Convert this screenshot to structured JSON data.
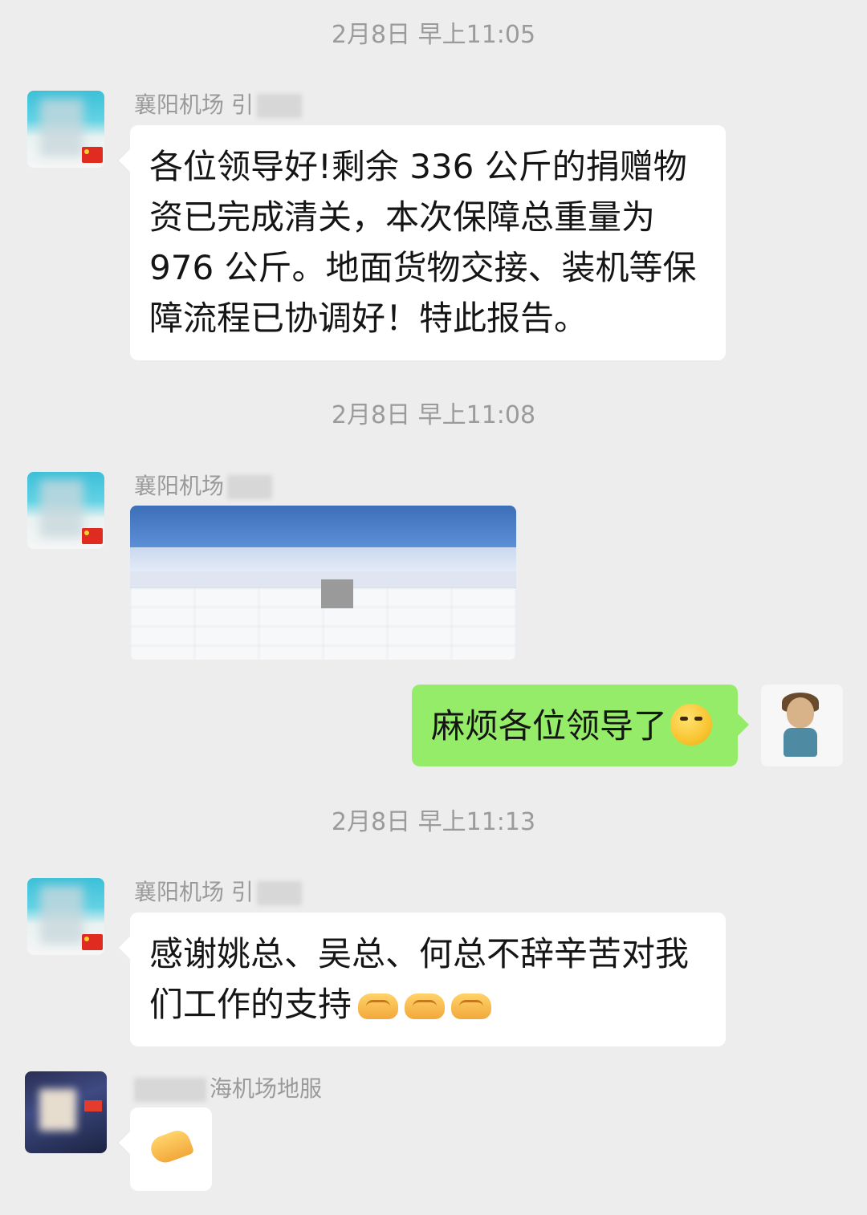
{
  "timestamps": [
    "2月8日 早上11:05",
    "2月8日 早上11:08",
    "2月8日 早上11:13"
  ],
  "messages": [
    {
      "sender": "襄阳机场 引",
      "text": "各位领导好!剩余 336 公斤的捐赠物资已完成清关，本次保障总重量为976 公斤。地面货物交接、装机等保障流程已协调好！特此报告。"
    },
    {
      "sender": "襄阳机场",
      "image_alt": "spreadsheet screenshot"
    },
    {
      "text": "麻烦各位领导了",
      "emoji": "thinking-face-icon"
    },
    {
      "sender": "襄阳机场 引",
      "text": "感谢姚总、吴总、何总不辞辛苦对我们工作的支持",
      "emoji": "handshake-icon"
    },
    {
      "sender": "海机场地服",
      "sticker": "ok-hand-icon"
    }
  ],
  "colors": {
    "background": "#ededed",
    "incoming_bubble": "#ffffff",
    "outgoing_bubble": "#95ec69",
    "timestamp": "#9b9b9b"
  }
}
